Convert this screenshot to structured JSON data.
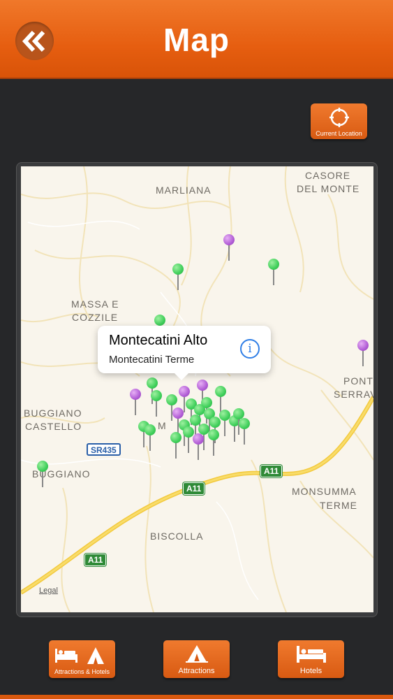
{
  "header": {
    "title": "Map"
  },
  "buttons": {
    "current_location": "Current Location"
  },
  "callout": {
    "title": "Montecatini Alto",
    "subtitle": "Montecatini Terme"
  },
  "map": {
    "places": {
      "marliana": "MARLIANA",
      "casore_line1": "CASORE",
      "casore_line2": "DEL MONTE",
      "massa_line1": "MASSA E",
      "massa_line2": "COZZILE",
      "buggiano_castello_line1": "BUGGIANO",
      "buggiano_castello_line2": "CASTELLO",
      "buggiano": "BUGGIANO",
      "ponte_line1": "PONT",
      "ponte_line2": "SERRAV",
      "monsummano_line1": "MONSUMMA",
      "monsummano_line2": "TERME",
      "biscolla": "BISCOLLA",
      "m_label": "M"
    },
    "roads": {
      "sr435": "SR435",
      "a11_a": "A11",
      "a11_b": "A11",
      "a11_c": "A11"
    },
    "legal": "Legal",
    "pin_colors": {
      "green": "#3fcf5a",
      "purple": "#b25ed6"
    }
  },
  "tabs": [
    {
      "label": "Attractions & Hotels"
    },
    {
      "label": "Attractions"
    },
    {
      "label": "Hotels"
    }
  ],
  "colors": {
    "accent": "#e8661a",
    "background": "#262729"
  }
}
